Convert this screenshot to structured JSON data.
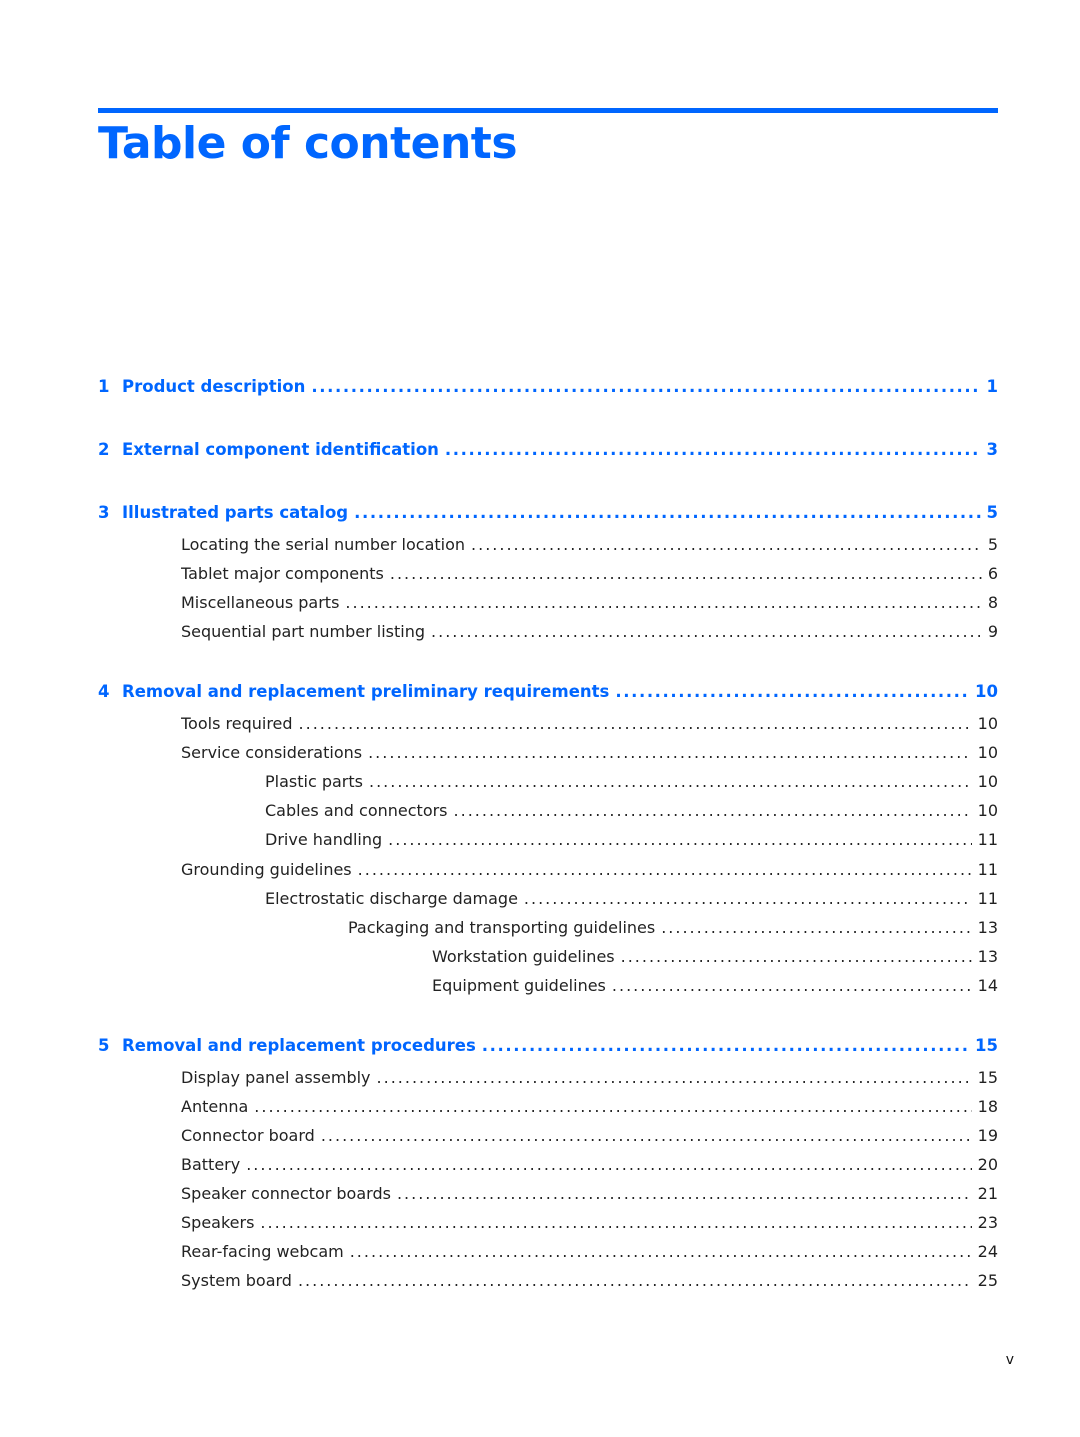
{
  "title": "Table of contents",
  "accent_color": "#0066ff",
  "footer_page": "v",
  "chapters": [
    {
      "num": "1",
      "label": "Product description",
      "page": "1"
    },
    {
      "num": "2",
      "label": "External component identification",
      "page": "3"
    },
    {
      "num": "3",
      "label": "Illustrated parts catalog",
      "page": "5",
      "sections": [
        {
          "label": "Locating the serial number location",
          "page": "5"
        },
        {
          "label": "Tablet major components",
          "page": "6"
        },
        {
          "label": "Miscellaneous parts",
          "page": "8"
        },
        {
          "label": "Sequential part number listing",
          "page": "9"
        }
      ]
    },
    {
      "num": "4",
      "label": "Removal and replacement preliminary requirements",
      "page": "10",
      "sections": [
        {
          "label": "Tools required",
          "page": "10"
        },
        {
          "label": "Service considerations",
          "page": "10"
        },
        {
          "label": "Plastic parts",
          "page": "10"
        },
        {
          "label": "Cables and connectors",
          "page": "10"
        },
        {
          "label": "Drive handling",
          "page": "11"
        },
        {
          "label": "Grounding guidelines",
          "page": "11"
        },
        {
          "label": "Electrostatic discharge damage",
          "page": "11"
        },
        {
          "label": "Packaging and transporting guidelines",
          "page": "13"
        },
        {
          "label": "Workstation guidelines",
          "page": "13"
        },
        {
          "label": "Equipment guidelines",
          "page": "14"
        }
      ]
    },
    {
      "num": "5",
      "label": "Removal and replacement procedures",
      "page": "15",
      "sections": [
        {
          "label": "Display panel assembly",
          "page": "15"
        },
        {
          "label": "Antenna",
          "page": "18"
        },
        {
          "label": "Connector board",
          "page": "19"
        },
        {
          "label": "Battery",
          "page": "20"
        },
        {
          "label": "Speaker connector boards",
          "page": "21"
        },
        {
          "label": "Speakers",
          "page": "23"
        },
        {
          "label": "Rear-facing webcam",
          "page": "24"
        },
        {
          "label": "System board",
          "page": "25"
        }
      ]
    }
  ]
}
